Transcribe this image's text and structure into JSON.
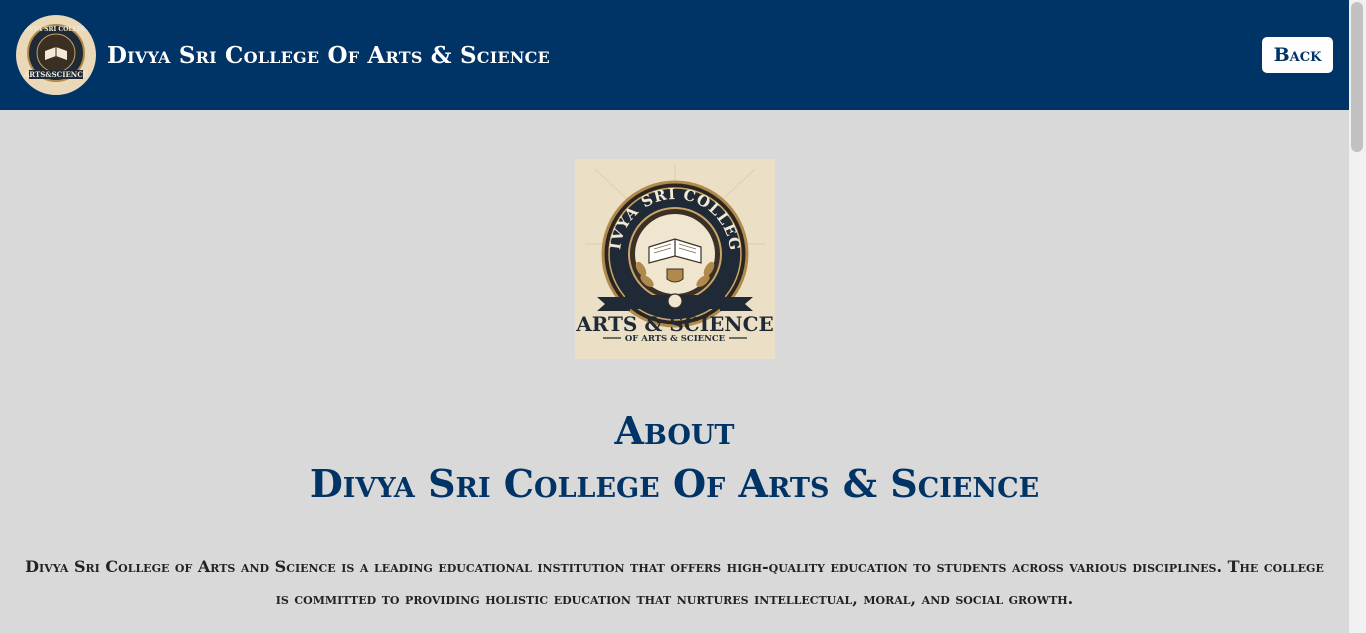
{
  "header": {
    "title": "Divya Sri College Of Arts & Science",
    "back_label": "Back"
  },
  "logo": {
    "icon": "college-emblem-icon",
    "top_text": "DIVYA SRI COLLEGE",
    "main_text": "ARTS & SCIENCE",
    "sub_text": "OF ARTS & SCIENCE"
  },
  "about": {
    "line1": "About",
    "line2": "Divya Sri College Of Arts & Science",
    "paragraph": "Divya Sri College of Arts and Science is a leading educational institution that offers high-quality education to students across various disciplines. The college is committed to providing holistic education that nurtures intellectual, moral, and social growth."
  },
  "colors": {
    "header_bg": "#003366",
    "page_bg": "#d9d9d9",
    "accent": "#003366"
  }
}
